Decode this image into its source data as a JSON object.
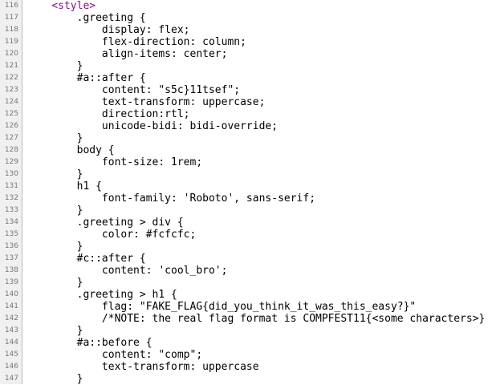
{
  "source_view": {
    "tag_color": "#881280",
    "lines": [
      {
        "number": "116",
        "text": "    <style>",
        "is_tag": true
      },
      {
        "number": "117",
        "text": "        .greeting {",
        "is_tag": false
      },
      {
        "number": "118",
        "text": "            display: flex;",
        "is_tag": false
      },
      {
        "number": "119",
        "text": "            flex-direction: column;",
        "is_tag": false
      },
      {
        "number": "120",
        "text": "            align-items: center;",
        "is_tag": false
      },
      {
        "number": "121",
        "text": "        }",
        "is_tag": false
      },
      {
        "number": "122",
        "text": "        #a::after {",
        "is_tag": false
      },
      {
        "number": "123",
        "text": "            content: \"s5c}11tsef\";",
        "is_tag": false
      },
      {
        "number": "124",
        "text": "            text-transform: uppercase;",
        "is_tag": false
      },
      {
        "number": "125",
        "text": "            direction:rtl;",
        "is_tag": false
      },
      {
        "number": "126",
        "text": "            unicode-bidi: bidi-override;",
        "is_tag": false
      },
      {
        "number": "127",
        "text": "        }",
        "is_tag": false
      },
      {
        "number": "128",
        "text": "        body {",
        "is_tag": false
      },
      {
        "number": "129",
        "text": "            font-size: 1rem;",
        "is_tag": false
      },
      {
        "number": "130",
        "text": "        }",
        "is_tag": false
      },
      {
        "number": "131",
        "text": "        h1 {",
        "is_tag": false
      },
      {
        "number": "132",
        "text": "            font-family: 'Roboto', sans-serif;",
        "is_tag": false
      },
      {
        "number": "133",
        "text": "        }",
        "is_tag": false
      },
      {
        "number": "134",
        "text": "        .greeting > div {",
        "is_tag": false
      },
      {
        "number": "135",
        "text": "            color: #fcfcfc;",
        "is_tag": false
      },
      {
        "number": "136",
        "text": "        }",
        "is_tag": false
      },
      {
        "number": "137",
        "text": "        #c::after {",
        "is_tag": false
      },
      {
        "number": "138",
        "text": "            content: 'cool_bro';",
        "is_tag": false
      },
      {
        "number": "139",
        "text": "        }",
        "is_tag": false
      },
      {
        "number": "140",
        "text": "        .greeting > h1 {",
        "is_tag": false
      },
      {
        "number": "141",
        "text": "            flag: \"FAKE_FLAG{did_you_think_it_was_this_easy?}\"",
        "is_tag": false
      },
      {
        "number": "142",
        "text": "            /*NOTE: the real flag format is COMPFEST11{<some characters>}",
        "is_tag": false
      },
      {
        "number": "143",
        "text": "        }",
        "is_tag": false
      },
      {
        "number": "144",
        "text": "        #a::before {",
        "is_tag": false
      },
      {
        "number": "145",
        "text": "            content: \"comp\";",
        "is_tag": false
      },
      {
        "number": "146",
        "text": "            text-transform: uppercase",
        "is_tag": false
      },
      {
        "number": "147",
        "text": "        }",
        "is_tag": false
      }
    ]
  }
}
